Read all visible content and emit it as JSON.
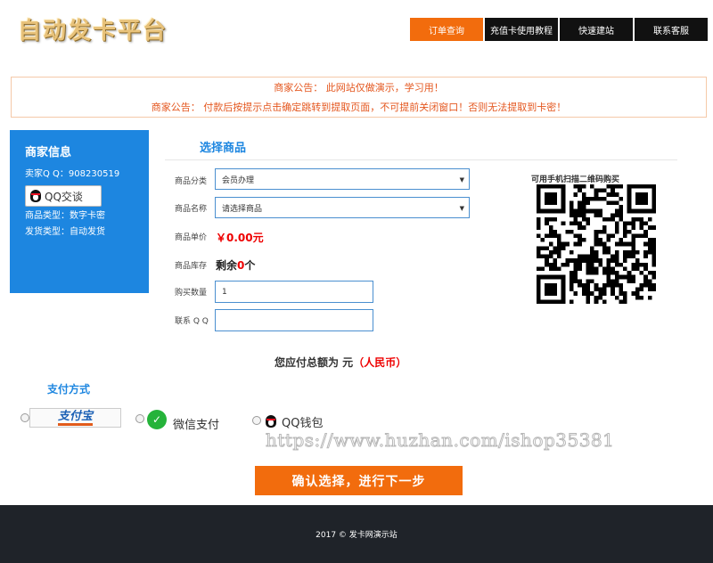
{
  "header": {
    "logo_text": "自动发卡平台",
    "nav": [
      "订单查询",
      "充值卡使用教程",
      "快速建站",
      "联系客服"
    ]
  },
  "notice": {
    "lines": [
      "商家公告： 此网站仅做演示，学习用！",
      "商家公告： 付款后按提示点击确定跳转到提取页面，不可提前关闭窗口！否则无法提取到卡密！"
    ]
  },
  "merchant": {
    "title": "商家信息",
    "seller_qq": "卖家Q Q：908230519",
    "qq_button": "QQ交谈",
    "product_type": "商品类型：数字卡密",
    "delivery_type": "发货类型：自动发货"
  },
  "product": {
    "section_title": "选择商品",
    "category_label": "商品分类",
    "category_value": "会员办理",
    "name_label": "商品名称",
    "name_value": "请选择商品",
    "price_label": "商品单价",
    "price_value": "￥0.00",
    "price_unit": "元",
    "stock_label": "商品库存",
    "stock_prefix": "剩余",
    "stock_value": "0",
    "stock_unit": "个",
    "quantity_label": "购买数量",
    "quantity_value": "1",
    "contact_label": "联系 Q Q",
    "contact_value": ""
  },
  "qr": {
    "label": "可用手机扫描二维码购买"
  },
  "total": {
    "prefix": "您应付总额为 元",
    "currency": "（人民币）"
  },
  "payment": {
    "title": "支付方式",
    "alipay_label": "支付宝",
    "wechat_label": "微信支付",
    "qq_label": "QQ钱包"
  },
  "watermark": "https://www.huzhan.com/ishop35381",
  "confirm_button": "确认选择，进行下一步",
  "footer": "2017 © 发卡网演示站"
}
